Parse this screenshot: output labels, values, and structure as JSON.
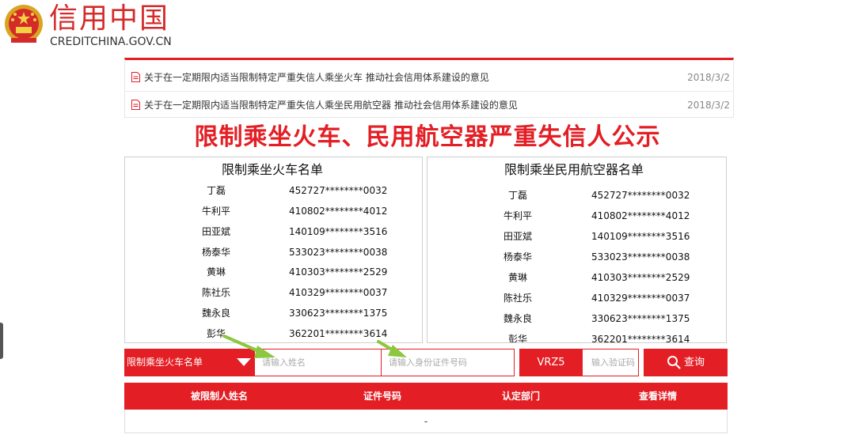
{
  "header": {
    "brand_cn": "信用中国",
    "brand_en": "CREDITCHINA.GOV.CN",
    "emblem_icon": "national-emblem-icon"
  },
  "news": [
    {
      "title": "关于在一定期限内适当限制特定严重失信人乘坐火车 推动社会信用体系建设的意见",
      "date": "2018/3/2"
    },
    {
      "title": "关于在一定期限内适当限制特定严重失信人乘坐民用航空器 推动社会信用体系建设的意见",
      "date": "2018/3/2"
    }
  ],
  "headline": "限制乘坐火车、民用航空器严重失信人公示",
  "train_list": {
    "title": "限制乘坐火车名单",
    "rows": [
      {
        "name": "丁磊",
        "id": "452727********0032"
      },
      {
        "name": "牛利平",
        "id": "410802********4012"
      },
      {
        "name": "田亚斌",
        "id": "140109********3516"
      },
      {
        "name": "杨泰华",
        "id": "533023********0038"
      },
      {
        "name": "黄琳",
        "id": "410303********2529"
      },
      {
        "name": "陈社乐",
        "id": "410329********0037"
      },
      {
        "name": "魏永良",
        "id": "330623********1375"
      },
      {
        "name": "彭华",
        "id": "362201********3614"
      }
    ]
  },
  "air_list": {
    "title": "限制乘坐民用航空器名单",
    "rows": [
      {
        "name": "丁磊",
        "id": "452727********0032"
      },
      {
        "name": "牛利平",
        "id": "410802********4012"
      },
      {
        "name": "田亚斌",
        "id": "140109********3516"
      },
      {
        "name": "杨泰华",
        "id": "533023********0038"
      },
      {
        "name": "黄琳",
        "id": "410303********2529"
      },
      {
        "name": "陈社乐",
        "id": "410329********0037"
      },
      {
        "name": "魏永良",
        "id": "330623********1375"
      },
      {
        "name": "彭华",
        "id": "362201********3614"
      }
    ]
  },
  "search": {
    "list_select": "限制乘坐火车名单",
    "name_placeholder": "请输入姓名",
    "id_placeholder": "请输入身份证件号码",
    "captcha_code": "VRZ5",
    "captcha_placeholder": "输入验证码",
    "query_label": "查询"
  },
  "results": {
    "columns": [
      "被限制人姓名",
      "证件号码",
      "认定部门",
      "查看详情"
    ],
    "empty_cell": "-"
  },
  "colors": {
    "accent": "#e31e24",
    "arrow": "#8dc63f"
  }
}
